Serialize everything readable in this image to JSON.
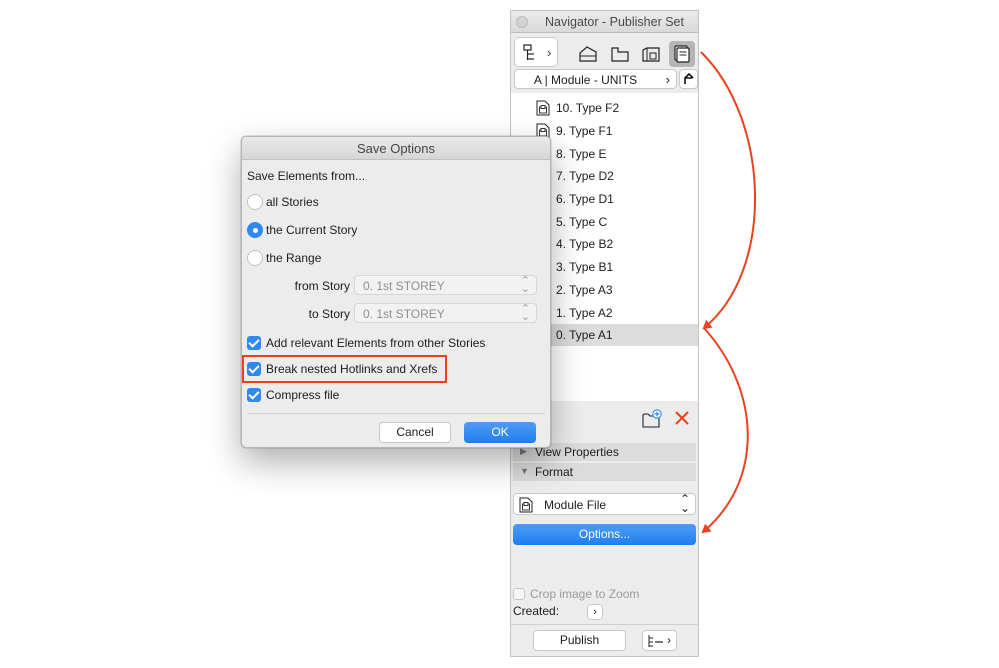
{
  "navigator": {
    "title": "Navigator - Publisher Set",
    "set_name": "A | Module - UNITS",
    "items": [
      "10. Type F2",
      "9. Type F1",
      "8. Type E",
      "7. Type D2",
      "6. Type D1",
      "5. Type C",
      "4. Type B2",
      "3. Type B1",
      "2. Type A3",
      "1. Type A2",
      "0. Type A1"
    ],
    "selected_item": "0. Type A1",
    "sections": {
      "view_properties": "View Properties",
      "format": "Format"
    },
    "format_value": "Module File",
    "options_label": "Options...",
    "crop_label": "Crop image to Zoom",
    "created_label": "Created:",
    "publish_label": "Publish",
    "icons": {
      "map": "project-map-icon",
      "story": "story-icon",
      "section": "section-icon",
      "3d": "3d-document-icon",
      "layout": "layout-book-icon",
      "up": "up-arrow-icon",
      "add": "add-folder-icon",
      "delete": "delete-x-icon",
      "tree": "tree-view-icon"
    }
  },
  "dialog": {
    "title": "Save Options",
    "save_label": "Save Elements from...",
    "radios": {
      "all": "all Stories",
      "current": "the Current Story",
      "range": "the Range"
    },
    "selected_radio": "current",
    "from_label": "from Story",
    "from_value": "0. 1st STOREY",
    "to_label": "to Story",
    "to_value": "0. 1st STOREY",
    "checks": {
      "relevant": "Add relevant Elements from other Stories",
      "break": "Break nested Hotlinks and Xrefs",
      "compress": "Compress file"
    },
    "cancel_label": "Cancel",
    "ok_label": "OK"
  },
  "colors": {
    "accent": "#2f88f3",
    "annotation": "#e8421f",
    "delete": "#e8421f"
  }
}
